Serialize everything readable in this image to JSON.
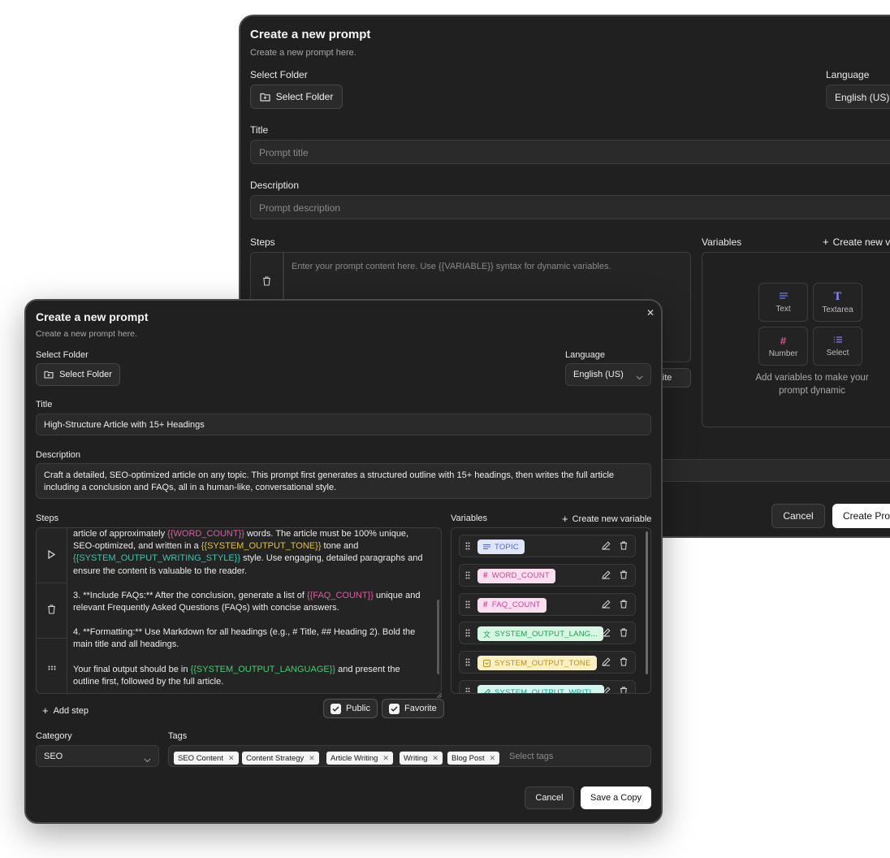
{
  "back": {
    "title": "Create a new prompt",
    "subtitle": "Create a new prompt here.",
    "folder_label": "Select Folder",
    "folder_button": "Select Folder",
    "language_label": "Language",
    "language_value": "English (US)",
    "title_label": "Title",
    "title_placeholder": "Prompt title",
    "description_label": "Description",
    "description_placeholder": "Prompt description",
    "steps_label": "Steps",
    "steps_placeholder": "Enter your prompt content here. Use {{VARIABLE}} syntax for dynamic variables.",
    "variables_label": "Variables",
    "create_variable": "Create new v",
    "var_types": [
      "Text",
      "Textarea",
      "Number",
      "Select"
    ],
    "empty_hint": "Add variables to make your prompt dynamic",
    "favorite_partial": "orite",
    "cancel": "Cancel",
    "create": "Create Pro"
  },
  "front": {
    "title": "Create a new prompt",
    "subtitle": "Create a new prompt here.",
    "folder_label": "Select Folder",
    "folder_button": "Select Folder",
    "language_label": "Language",
    "language_value": "English (US)",
    "title_label": "Title",
    "title_value": "High-Structure Article with 15+ Headings",
    "description_label": "Description",
    "description_value": "Craft a detailed, SEO-optimized article on any topic. This prompt first generates a structured outline with 15+ headings, then writes the full article including a conclusion and FAQs, all in a human-like, conversational style.",
    "steps_label": "Steps",
    "steps": {
      "p1_a": "article of approximately ",
      "p1_v1": "{{WORD_COUNT}}",
      "p1_b": " words. The article must be 100% unique, SEO-optimized, and written in a ",
      "p1_v2": "{{SYSTEM_OUTPUT_TONE}}",
      "p1_c": " tone and ",
      "p1_v3": "{{SYSTEM_OUTPUT_WRITING_STYLE}}",
      "p1_d": " style. Use engaging, detailed paragraphs and ensure the content is valuable to the reader.",
      "p2_a": "3.  **Include FAQs:** After the conclusion, generate a list of ",
      "p2_v1": "{{FAQ_COUNT}}",
      "p2_b": " unique and relevant Frequently Asked Questions (FAQs) with concise answers.",
      "p3": "4.  **Formatting:** Use Markdown for all headings (e.g., # Title, ## Heading 2). Bold the main title and all headings.",
      "p4_a": "Your final output should be in ",
      "p4_v1": "{{SYSTEM_OUTPUT_LANGUAGE}}",
      "p4_b": " and present the outline first, followed by the full article."
    },
    "add_step": "Add step",
    "public": "Public",
    "favorite": "Favorite",
    "variables_label": "Variables",
    "create_variable": "Create new variable",
    "variables": [
      {
        "name": "TOPIC",
        "icon": "text-lines-icon",
        "bg": "#dfe6fb",
        "fg": "#4a63d8"
      },
      {
        "name": "WORD_COUNT",
        "icon": "hash-icon",
        "bg": "#fbdff0",
        "fg": "#d1448e"
      },
      {
        "name": "FAQ_COUNT",
        "icon": "hash-icon",
        "bg": "#fbdff0",
        "fg": "#d1448e"
      },
      {
        "name": "SYSTEM_OUTPUT_LANG...",
        "icon": "translate-icon",
        "bg": "#d7f6e2",
        "fg": "#1f9d54"
      },
      {
        "name": "SYSTEM_OUTPUT_TONE",
        "icon": "select-icon",
        "bg": "#fbf0c4",
        "fg": "#b8900d"
      },
      {
        "name": "SYSTEM_OUTPUT_WRITI...",
        "icon": "pen-icon",
        "bg": "#d3f4ef",
        "fg": "#15a08a"
      }
    ],
    "category_label": "Category",
    "category_value": "SEO",
    "tags_label": "Tags",
    "tags": [
      "SEO Content",
      "Content Strategy",
      "Article Writing",
      "Writing",
      "Blog Post"
    ],
    "tags_placeholder": "Select tags",
    "cancel": "Cancel",
    "save": "Save a Copy"
  }
}
